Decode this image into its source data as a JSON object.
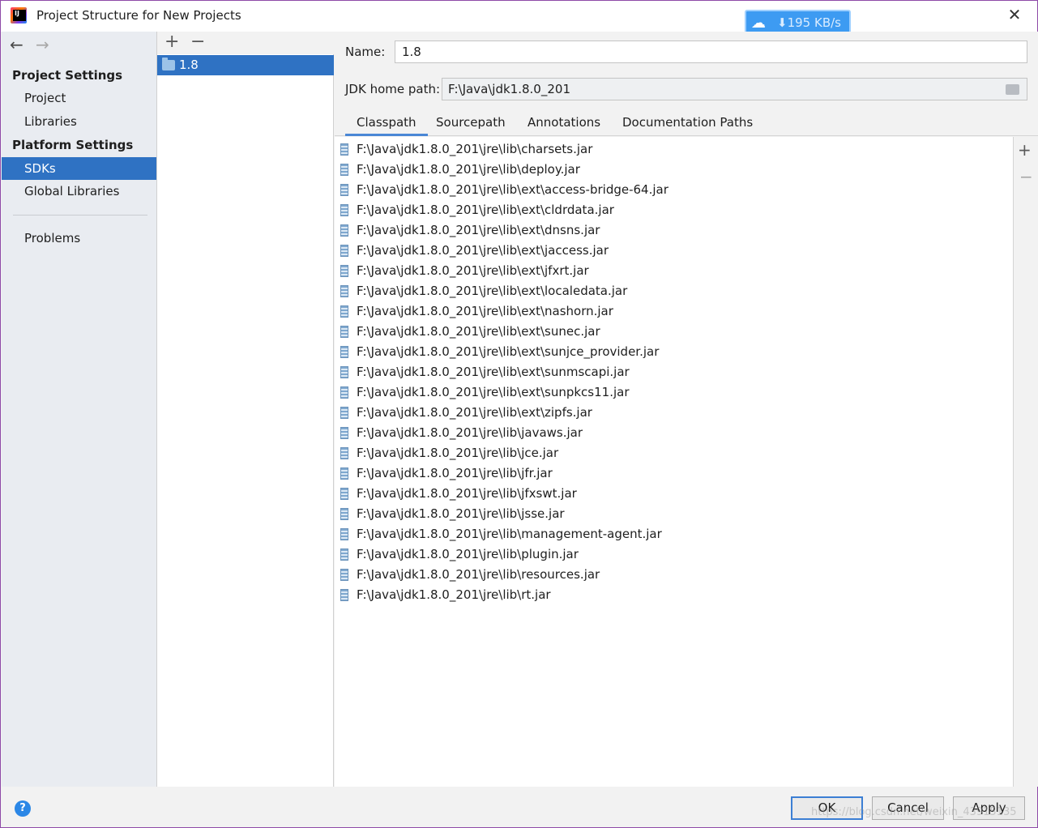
{
  "window": {
    "title": "Project Structure for New Projects",
    "close_glyph": "✕"
  },
  "download_badge": {
    "speed": "195 KB/s",
    "arrow": "⬇"
  },
  "nav": {
    "back_glyph": "←",
    "forward_glyph": "→",
    "project_settings_header": "Project Settings",
    "platform_settings_header": "Platform Settings",
    "items": [
      {
        "label": "Project"
      },
      {
        "label": "Libraries"
      },
      {
        "label": "SDKs",
        "selected": true
      },
      {
        "label": "Global Libraries"
      },
      {
        "label": "Problems"
      }
    ],
    "help_glyph": "?"
  },
  "sdk_list": {
    "add_glyph": "+",
    "remove_glyph": "−",
    "items": [
      {
        "label": "1.8",
        "selected": true
      }
    ]
  },
  "detail": {
    "name_label": "Name:",
    "name_value": "1.8",
    "jdk_label": "JDK home path:",
    "jdk_value": "F:\\Java\\jdk1.8.0_201",
    "tabs": [
      {
        "label": "Classpath",
        "active": true
      },
      {
        "label": "Sourcepath"
      },
      {
        "label": "Annotations"
      },
      {
        "label": "Documentation Paths"
      }
    ],
    "side_add_glyph": "+",
    "side_remove_glyph": "−",
    "classpath": [
      "F:\\Java\\jdk1.8.0_201\\jre\\lib\\charsets.jar",
      "F:\\Java\\jdk1.8.0_201\\jre\\lib\\deploy.jar",
      "F:\\Java\\jdk1.8.0_201\\jre\\lib\\ext\\access-bridge-64.jar",
      "F:\\Java\\jdk1.8.0_201\\jre\\lib\\ext\\cldrdata.jar",
      "F:\\Java\\jdk1.8.0_201\\jre\\lib\\ext\\dnsns.jar",
      "F:\\Java\\jdk1.8.0_201\\jre\\lib\\ext\\jaccess.jar",
      "F:\\Java\\jdk1.8.0_201\\jre\\lib\\ext\\jfxrt.jar",
      "F:\\Java\\jdk1.8.0_201\\jre\\lib\\ext\\localedata.jar",
      "F:\\Java\\jdk1.8.0_201\\jre\\lib\\ext\\nashorn.jar",
      "F:\\Java\\jdk1.8.0_201\\jre\\lib\\ext\\sunec.jar",
      "F:\\Java\\jdk1.8.0_201\\jre\\lib\\ext\\sunjce_provider.jar",
      "F:\\Java\\jdk1.8.0_201\\jre\\lib\\ext\\sunmscapi.jar",
      "F:\\Java\\jdk1.8.0_201\\jre\\lib\\ext\\sunpkcs11.jar",
      "F:\\Java\\jdk1.8.0_201\\jre\\lib\\ext\\zipfs.jar",
      "F:\\Java\\jdk1.8.0_201\\jre\\lib\\javaws.jar",
      "F:\\Java\\jdk1.8.0_201\\jre\\lib\\jce.jar",
      "F:\\Java\\jdk1.8.0_201\\jre\\lib\\jfr.jar",
      "F:\\Java\\jdk1.8.0_201\\jre\\lib\\jfxswt.jar",
      "F:\\Java\\jdk1.8.0_201\\jre\\lib\\jsse.jar",
      "F:\\Java\\jdk1.8.0_201\\jre\\lib\\management-agent.jar",
      "F:\\Java\\jdk1.8.0_201\\jre\\lib\\plugin.jar",
      "F:\\Java\\jdk1.8.0_201\\jre\\lib\\resources.jar",
      "F:\\Java\\jdk1.8.0_201\\jre\\lib\\rt.jar"
    ]
  },
  "buttons": {
    "ok": "OK",
    "cancel": "Cancel",
    "apply": "Apply"
  },
  "watermark": "https://blog.csdn.net/weixin_43915135",
  "colors": {
    "selection": "#2f72c3",
    "nav_background": "#e9ecf1",
    "window_border": "#8e4aa8",
    "badge": "#3d9bf2"
  }
}
